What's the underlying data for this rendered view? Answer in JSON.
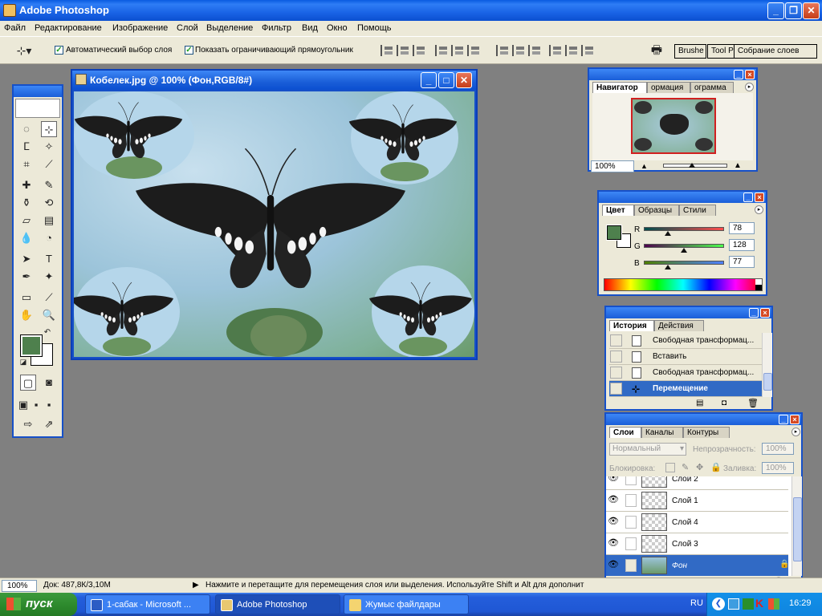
{
  "window": {
    "title": "Adobe Photoshop"
  },
  "menu": [
    "Файл",
    "Редактирование",
    "Изображение",
    "Слой",
    "Выделение",
    "Фильтр",
    "Вид",
    "Окно",
    "Помощь"
  ],
  "options": {
    "auto_select_label": "Автоматический выбор слоя",
    "show_bounds_label": "Показать ограничивающий прямоугольник",
    "palette_well_tabs": [
      "Brushe",
      "Tool P",
      "Собрание слоев"
    ]
  },
  "document": {
    "title": "Кобелек.jpg @ 100% (Фон,RGB/8#)"
  },
  "navigator": {
    "tabs": [
      "Навигатор",
      "ормация",
      "ограмма"
    ],
    "zoom": "100%"
  },
  "color_palette": {
    "tabs": [
      "Цвет",
      "Образцы",
      "Стили"
    ],
    "channels": [
      {
        "label": "R",
        "value": "78"
      },
      {
        "label": "G",
        "value": "128"
      },
      {
        "label": "B",
        "value": "77"
      }
    ],
    "foreground": "#4e804d"
  },
  "history": {
    "tabs": [
      "История",
      "Действия"
    ],
    "items": [
      {
        "label": "Свободная трансформац..."
      },
      {
        "label": "Вставить"
      },
      {
        "label": "Свободная трансформац..."
      },
      {
        "label": "Перемещение"
      }
    ]
  },
  "layers": {
    "tabs": [
      "Слои",
      "Каналы",
      "Контуры"
    ],
    "blend_mode": "Нормальный",
    "opacity_label": "Непрозрачность:",
    "opacity_value": "100%",
    "lock_label": "Блокировка:",
    "fill_label": "Заливка:",
    "fill_value": "100%",
    "items": [
      {
        "name": "Слой 2"
      },
      {
        "name": "Слой 1"
      },
      {
        "name": "Слой 4"
      },
      {
        "name": "Слой 3"
      },
      {
        "name": "Фон"
      }
    ]
  },
  "status": {
    "zoom": "100%",
    "doc": "Док: 487,8К/3,10М",
    "hint": "Нажмите и перетащите для перемещения слоя или выделения. Используйте Shift и Alt для дополнит"
  },
  "taskbar": {
    "start": "пуск",
    "tasks": [
      "1-сабак - Microsoft ...",
      "Adobe Photoshop",
      "Жумыс файлдары"
    ],
    "lang": "RU",
    "clock": "16:29"
  }
}
